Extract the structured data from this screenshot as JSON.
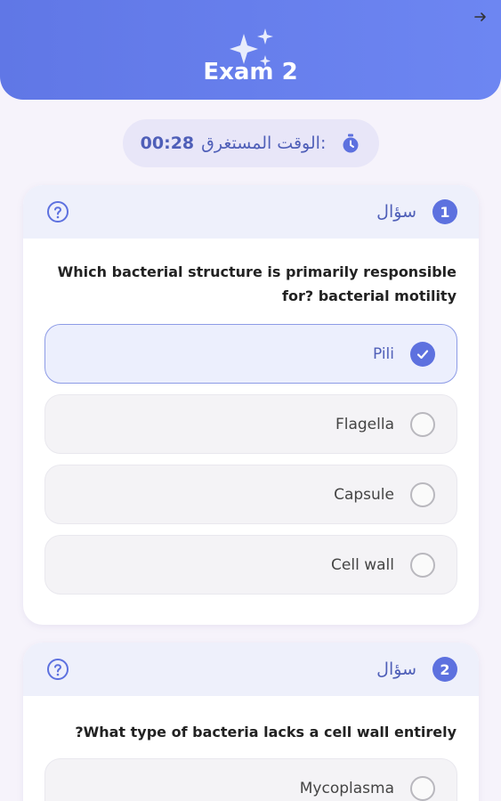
{
  "header": {
    "title": "Exam 2",
    "accent_color": "#6077e6",
    "back_icon": "arrow-right-icon",
    "decor_icon": "sparkles-icon"
  },
  "timer": {
    "label": "الوقت المستغرق:",
    "value": "00:28",
    "icon": "stopwatch-icon"
  },
  "questions": [
    {
      "number": "1",
      "label": "سؤال",
      "text": "Which bacterial structure is primarily responsible for? bacterial motility",
      "options": [
        {
          "label": "Pili",
          "selected": true
        },
        {
          "label": "Flagella",
          "selected": false
        },
        {
          "label": "Capsule",
          "selected": false
        },
        {
          "label": "Cell wall",
          "selected": false
        }
      ]
    },
    {
      "number": "2",
      "label": "سؤال",
      "text": "What type of bacteria lacks a cell wall entirely?",
      "options": [
        {
          "label": "Mycoplasma",
          "selected": false
        }
      ]
    }
  ]
}
